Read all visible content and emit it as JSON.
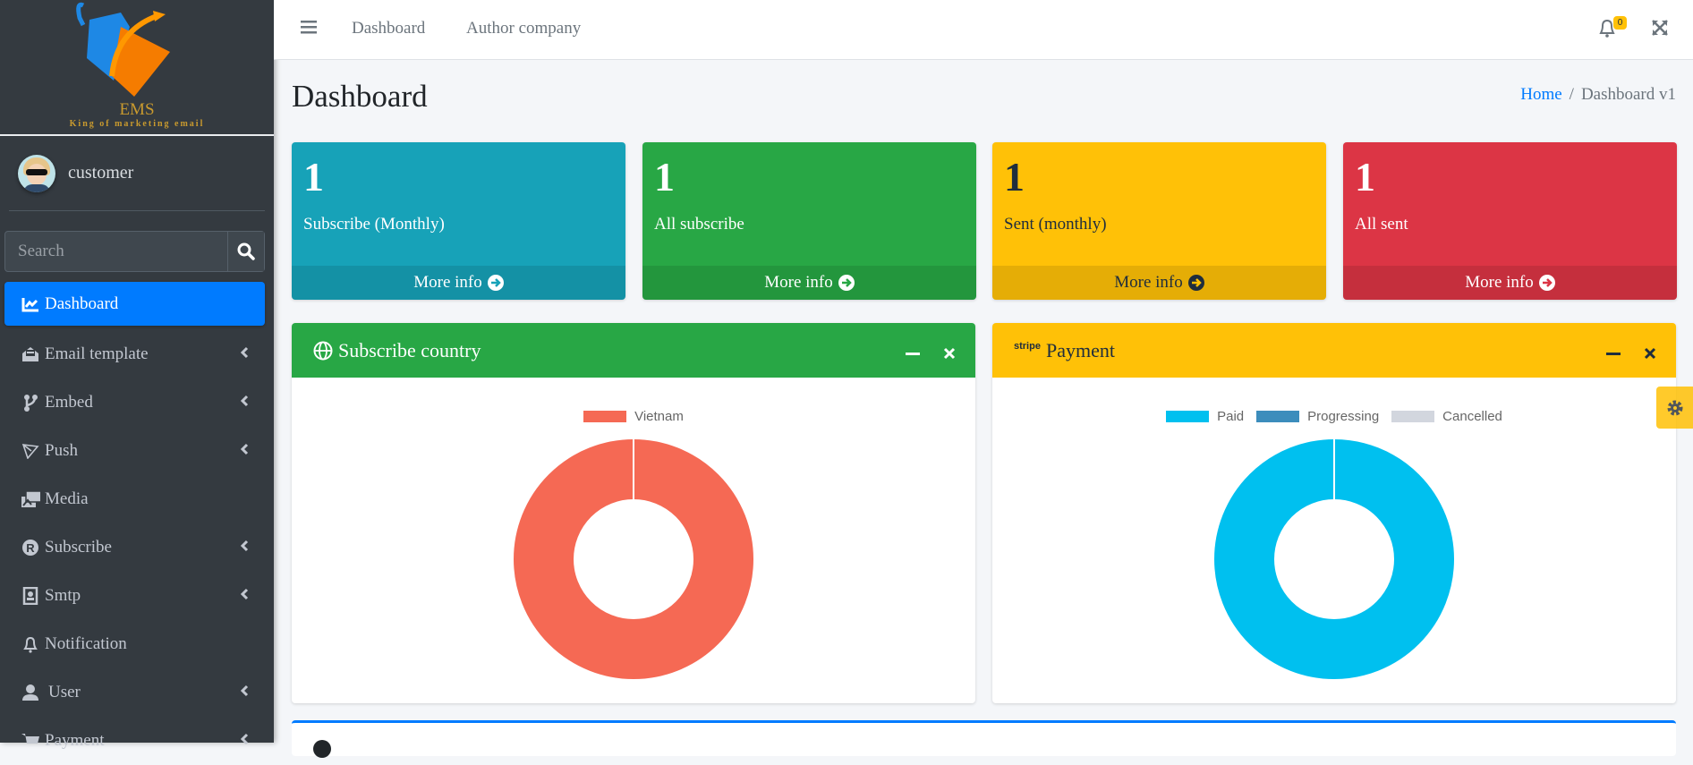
{
  "brand": {
    "name": "EMS",
    "tagline": "King of marketing email"
  },
  "user": {
    "name": "customer"
  },
  "search": {
    "placeholder": "Search"
  },
  "sidebar": {
    "items": [
      {
        "label": "Dashboard",
        "icon": "chart-line-icon",
        "active": true
      },
      {
        "label": "Email template",
        "icon": "envelope-open-icon",
        "chevron": true
      },
      {
        "label": "Embed",
        "icon": "code-branch-icon",
        "chevron": true
      },
      {
        "label": "Push",
        "icon": "paper-plane-icon",
        "chevron": true
      },
      {
        "label": "Media",
        "icon": "photo-video-icon"
      },
      {
        "label": "Subscribe",
        "icon": "registered-icon",
        "chevron": true
      },
      {
        "label": "Smtp",
        "icon": "address-book-icon",
        "chevron": true
      },
      {
        "label": "Notification",
        "icon": "bell-icon"
      },
      {
        "label": "User",
        "icon": "user-icon",
        "chevron": true
      },
      {
        "label": "Payment",
        "icon": "cart-icon",
        "chevron": true
      }
    ]
  },
  "header": {
    "links": [
      "Dashboard",
      "Author company"
    ],
    "notification_count": "0"
  },
  "page": {
    "title": "Dashboard",
    "breadcrumb": {
      "home": "Home",
      "current": "Dashboard v1"
    }
  },
  "stats": [
    {
      "value": "1",
      "label": "Subscribe (Monthly)",
      "more": "More info",
      "color": "#17a2b8"
    },
    {
      "value": "1",
      "label": "All subscribe",
      "more": "More info",
      "color": "#28a745"
    },
    {
      "value": "1",
      "label": "Sent (monthly)",
      "more": "More info",
      "color": "#ffc107"
    },
    {
      "value": "1",
      "label": "All sent",
      "more": "More info",
      "color": "#dc3545"
    }
  ],
  "cards": {
    "country": {
      "title": "Subscribe country"
    },
    "payment": {
      "title": "Payment",
      "brand": "stripe"
    }
  },
  "chart_data": [
    {
      "type": "pie",
      "title": "Subscribe country",
      "categories": [
        "Vietnam"
      ],
      "values": [
        1
      ],
      "colors": [
        "#f56954"
      ],
      "legend": "top"
    },
    {
      "type": "pie",
      "title": "Payment",
      "categories": [
        "Paid",
        "Progressing",
        "Cancelled"
      ],
      "values": [
        1,
        0,
        0
      ],
      "colors": [
        "#00c0ef",
        "#3c8dbc",
        "#d2d6de"
      ],
      "legend": "top"
    }
  ]
}
